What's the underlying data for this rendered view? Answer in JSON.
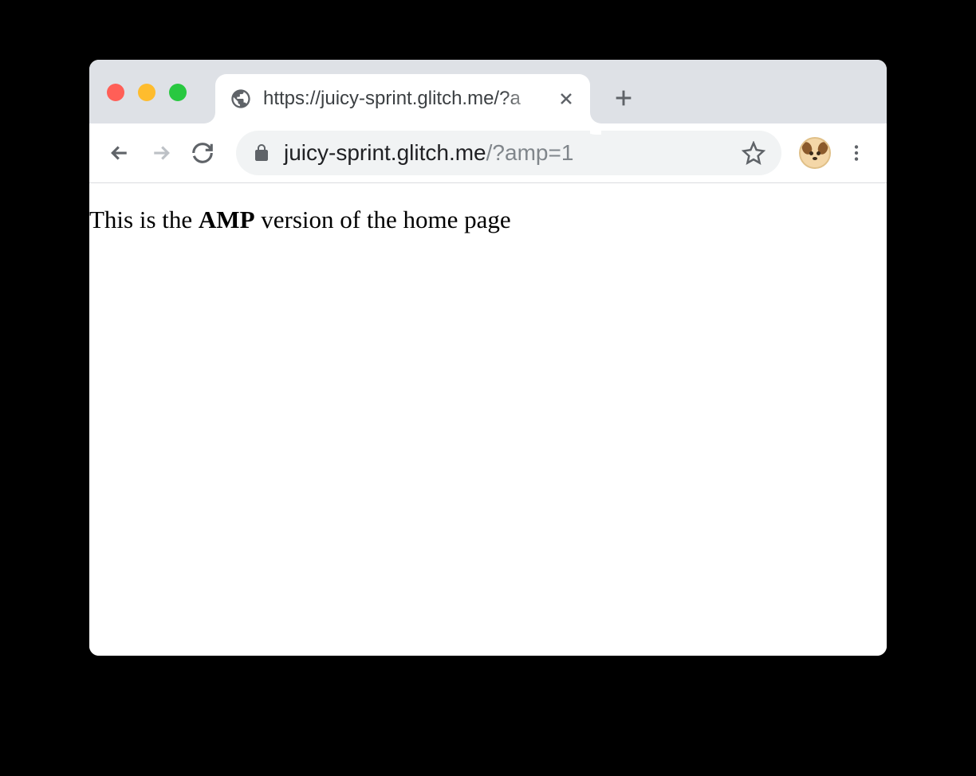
{
  "window": {
    "tab": {
      "title": "https://juicy-sprint.glitch.me/?a"
    },
    "toolbar": {
      "url_host": "juicy-sprint.glitch.me",
      "url_path": "/?amp=1"
    }
  },
  "page": {
    "text_before": "This is the ",
    "text_bold": "AMP",
    "text_after": " version of the home page"
  }
}
